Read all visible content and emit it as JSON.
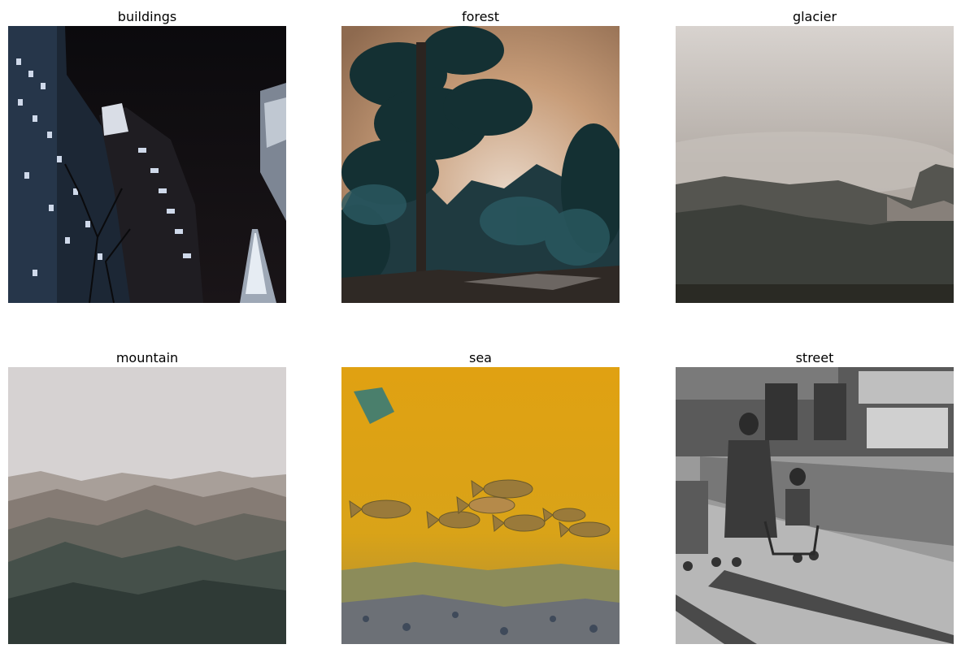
{
  "panels": [
    {
      "label": "buildings"
    },
    {
      "label": "forest"
    },
    {
      "label": "glacier"
    },
    {
      "label": "mountain"
    },
    {
      "label": "sea"
    },
    {
      "label": "street"
    }
  ],
  "colors": {
    "background": "#ffffff",
    "text": "#000000"
  }
}
